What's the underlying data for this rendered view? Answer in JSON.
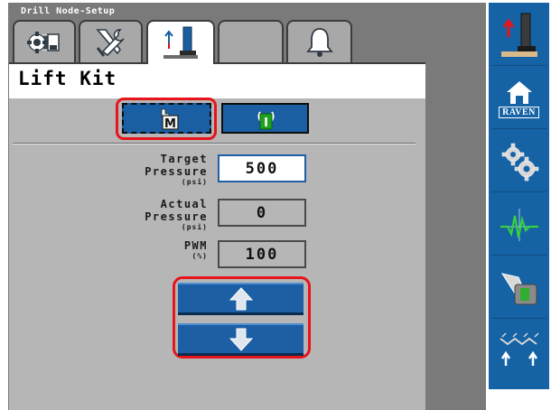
{
  "app": {
    "title": "Drill Node-Setup"
  },
  "tabs": [
    {
      "name": "settings-tab",
      "icon": "machine-gear-icon",
      "active": false
    },
    {
      "name": "tools-tab",
      "icon": "wrench-tools-icon",
      "active": false
    },
    {
      "name": "lift-kit-tab",
      "icon": "lift-kit-icon",
      "active": true
    },
    {
      "name": "blank-tab",
      "icon": "",
      "active": false
    },
    {
      "name": "alarms-tab",
      "icon": "bell-icon",
      "active": false
    }
  ],
  "page": {
    "title": "Lift Kit"
  },
  "mode": {
    "manual_label": "M",
    "manual_selected": true,
    "auto_label": "I"
  },
  "fields": {
    "target_pressure": {
      "label_line1": "Target",
      "label_line2": "Pressure",
      "unit": "(psi)",
      "value": "500"
    },
    "actual_pressure": {
      "label_line1": "Actual",
      "label_line2": "Pressure",
      "unit": "(psi)",
      "value": "0"
    },
    "pwm": {
      "label_line1": "PWM",
      "unit": "(%)",
      "value": "100"
    }
  },
  "controls": {
    "raise_icon": "arrow-up-icon",
    "lower_icon": "arrow-down-icon"
  },
  "sidebar": {
    "items": [
      {
        "name": "lift-status",
        "icon": "lift-status-icon"
      },
      {
        "name": "home",
        "icon": "home-icon",
        "label": "RAVEN"
      },
      {
        "name": "settings",
        "icon": "gears-icon"
      },
      {
        "name": "diagnostics",
        "icon": "waveform-icon"
      },
      {
        "name": "switch",
        "icon": "toggle-switch-icon"
      },
      {
        "name": "tool-raise-lower",
        "icon": "tool-lift-icon"
      }
    ]
  },
  "colors": {
    "accent_blue": "#1562a5",
    "highlight_red": "#e8141b",
    "panel_gray": "#b6b6b6",
    "tab_gray": "#a8a8a8",
    "button_green": "#1fa21f"
  }
}
